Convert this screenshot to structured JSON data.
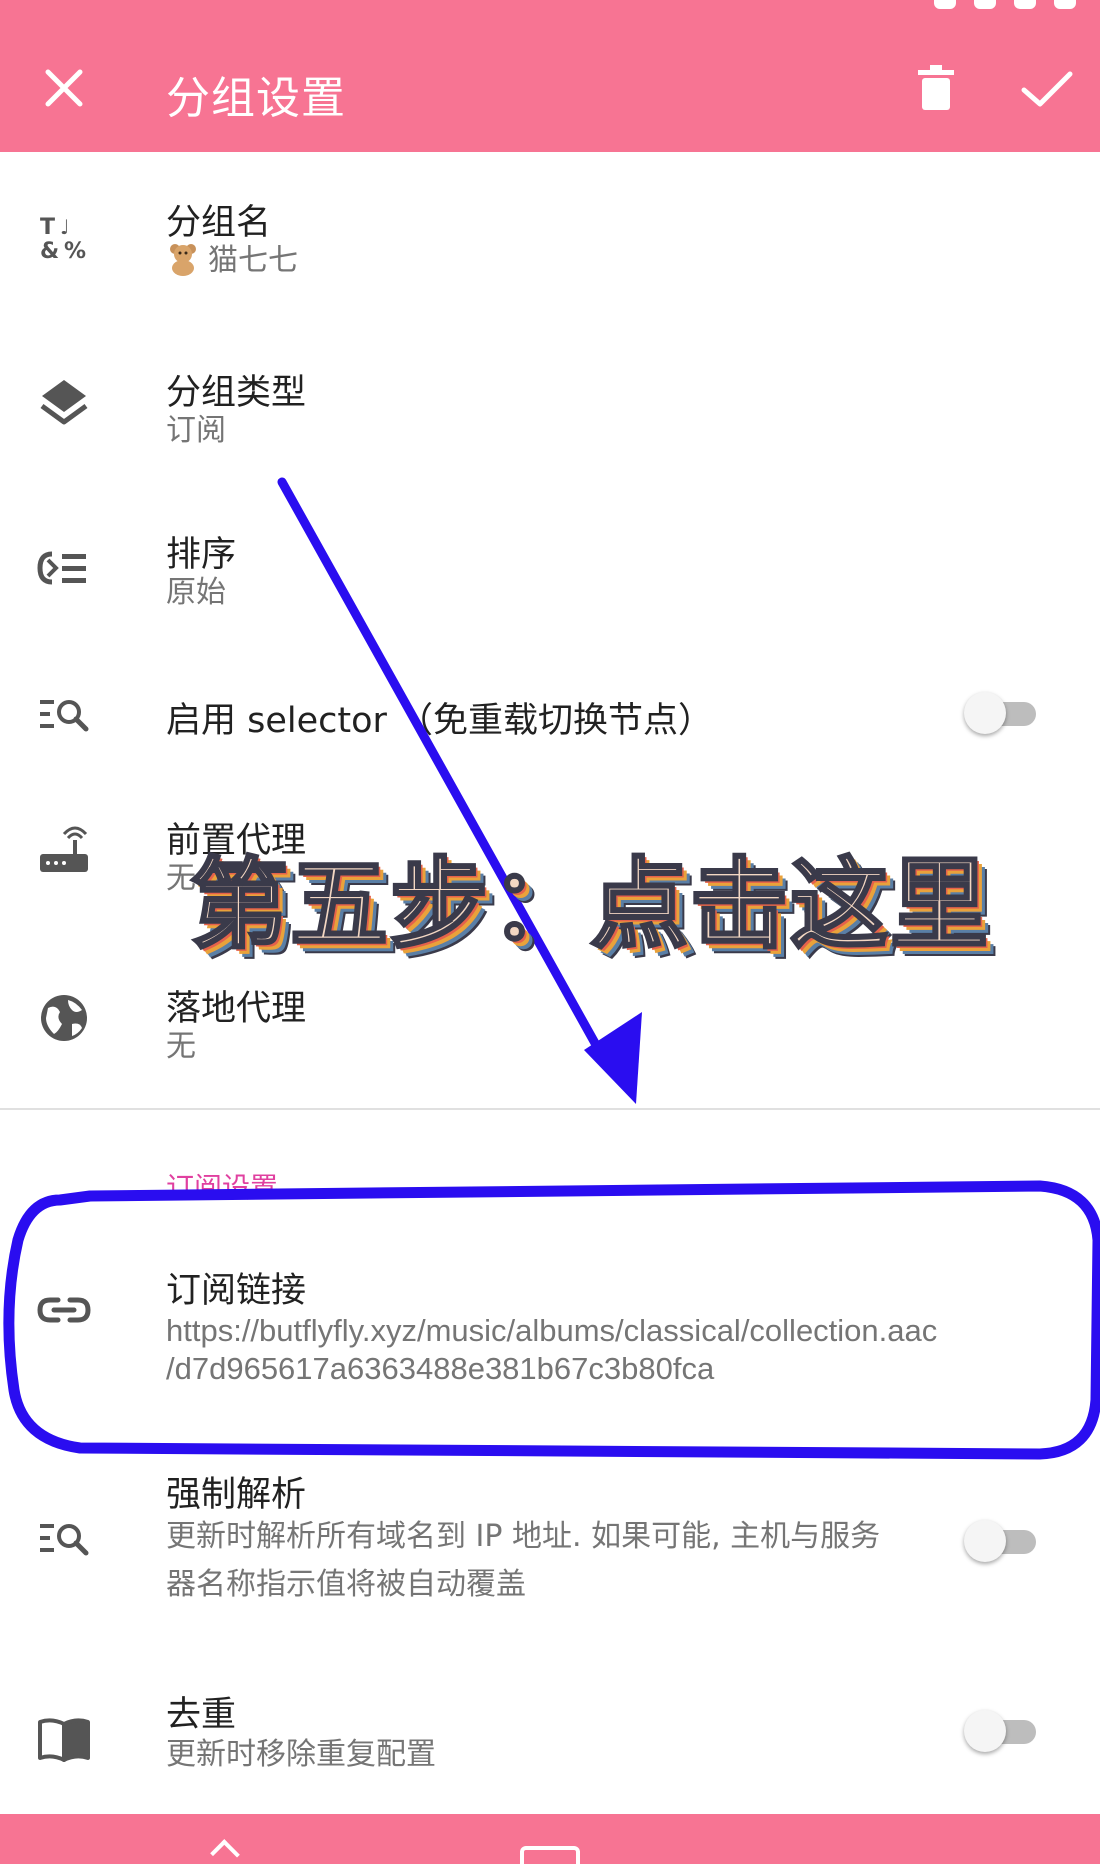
{
  "app_bar": {
    "title": "分组设置",
    "close_icon": "close-icon",
    "delete_icon": "delete-icon",
    "confirm_icon": "check-icon",
    "background": "#f77493"
  },
  "rows": {
    "group_name": {
      "title": "分组名",
      "value": "猫七七",
      "value_emoji": "teddy-bear-icon",
      "icon": "text-format-icon"
    },
    "group_type": {
      "title": "分组类型",
      "value": "订阅",
      "icon": "layers-icon"
    },
    "order": {
      "title": "排序",
      "value": "原始",
      "icon": "sort-icon"
    },
    "selector": {
      "title": "启用 selector （免重载切换节点）",
      "icon": "search-list-icon",
      "enabled": false
    },
    "front_proxy": {
      "title": "前置代理",
      "value": "无",
      "icon": "router-icon"
    },
    "landing_proxy": {
      "title": "落地代理",
      "value": "无",
      "icon": "globe-icon"
    }
  },
  "subscription_section": {
    "label": "订阅设置",
    "label_color": "#e040a0",
    "link": {
      "title": "订阅链接",
      "value_line1": "https://butflyfly.xyz/music/albums/classical/collection.aac",
      "value_line2": "/d7d965617a6363488e381b67c3b80fca",
      "icon": "link-icon"
    },
    "force_resolve": {
      "title": "强制解析",
      "desc_line1": "更新时解析所有域名到 IP 地址. 如果可能, 主机与服务",
      "desc_line2": "器名称指示值将被自动覆盖",
      "icon": "search-list-icon",
      "enabled": false
    },
    "dedup": {
      "title": "去重",
      "desc": "更新时移除重复配置",
      "icon": "book-icon",
      "enabled": false
    }
  },
  "annotation": {
    "banner_text": "第五步：点击这里",
    "arrow_color": "#2a0df0",
    "highlight_color": "#2a0df0"
  }
}
